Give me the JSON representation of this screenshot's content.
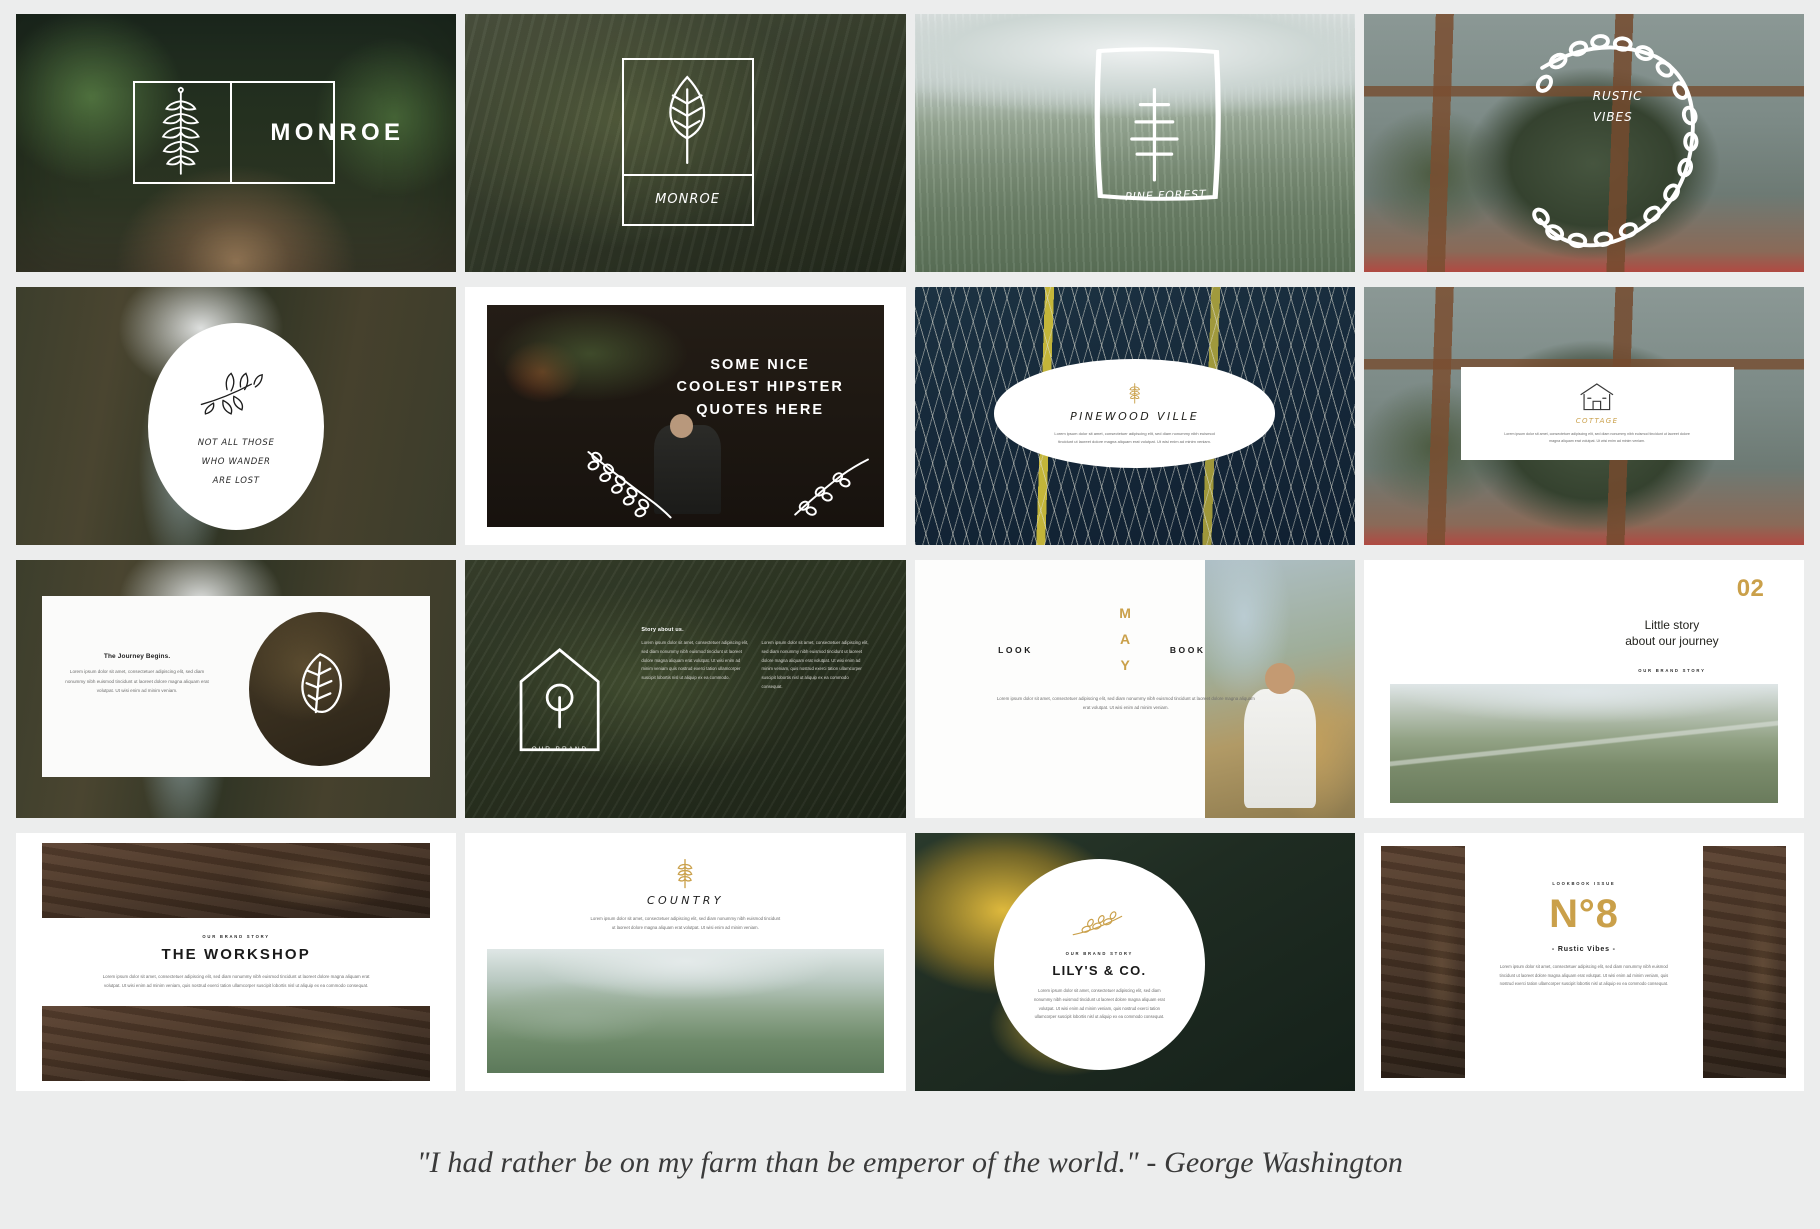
{
  "caption": "\"I had rather be on my farm than be emperor of the world.\" - George Washington",
  "palette": {
    "page_background": "#eceded",
    "slide_background": "#ffffff",
    "gold_accent": "#caa04a",
    "ink": "#1a1a1a",
    "muted_text": "#6d6d6d"
  },
  "lorem": {
    "short": "Lorem ipsum dolor sit amet, consectetuer adipiscing elit, sed diam nonummy nibh euismod tincidunt ut laoreet dolore magna aliquam erat volutpat. Ut wisi enim ad minim veniam.",
    "medium": "Lorem ipsum dolor sit amet, consectetuer adipiscing elit, sed diam nonummy nibh euismod tincidunt ut laoreet dolore magna aliquam erat volutpat. Ut wisi enim ad minim veniam, quis nostrud exerci tation ullamcorper suscipit lobortis nisl ut aliquip ex ea commodo consequat.",
    "column": "Lorem ipsum dolor sit amet, consectetuer adipiscing elit, sed diam nonummy nibh euismod tincidunt ut laoreet dolore magna aliquam erat volutpat. Ut wisi enim ad minim veniam quis nostrud exerci tation ullamcorper suscipit lobortis nisl ut aliquip ex ea commodo."
  },
  "slides": [
    {
      "id": "monroe-cover",
      "title": "MONROE",
      "icon": "fern-leaf-icon",
      "photo": "forest-bridge-photo",
      "layout": "framed-logo-lockup"
    },
    {
      "id": "monroe-leaf-badge",
      "title": "MONROE",
      "icon": "leaf-outline-icon",
      "photo": "tall-grass-photo",
      "layout": "vertical-frame-badge"
    },
    {
      "id": "pine-forest",
      "title": "PINE FOREST",
      "icon": "pine-tree-icon",
      "photo": "pine-forest-overlook-photo",
      "layout": "sketch-frame-title"
    },
    {
      "id": "rustic-vibes",
      "title_line1": "RUSTIC",
      "title_line2": "VIBES",
      "icon": "laurel-wreath-icon",
      "photo": "greenhouse-agave-photo",
      "layout": "wreath-title"
    },
    {
      "id": "wander-quote",
      "quote_line1": "NOT ALL THOSE",
      "quote_line2": "WHO WANDER",
      "quote_line3": "ARE LOST",
      "icon": "olive-branch-icon",
      "photo": "canyon-river-photo",
      "layout": "circle-quote"
    },
    {
      "id": "hipster-quotes",
      "quote_line1": "SOME NICE",
      "quote_line2": "COOLEST HIPSTER",
      "quote_line3": "QUOTES HERE",
      "icon": "vine-garland-icon",
      "photo": "hipster-portrait-photo",
      "layout": "full-bleed-quote"
    },
    {
      "id": "pinewood-ville",
      "title": "PINEWOOD VILLE",
      "icon": "wheat-sprig-icon",
      "photo": "palm-frond-photo",
      "layout": "oval-card"
    },
    {
      "id": "cottage",
      "title": "COTTAGE",
      "icon": "cottage-house-icon",
      "photo": "greenhouse-agave-photo",
      "layout": "paper-card"
    },
    {
      "id": "journey-begins",
      "title": "The Journey Begins.",
      "icon": "oak-leaf-icon",
      "photo": "canyon-river-photo",
      "layout": "panel-with-circle-photo"
    },
    {
      "id": "our-brand",
      "title": "OUR BRAND",
      "section_label": "Story about us.",
      "icon": "home-outline-icon",
      "photo": "hedge-leaves-photo",
      "layout": "badge-plus-two-columns"
    },
    {
      "id": "may-look-book",
      "month": "MAY",
      "left_label": "LOOK",
      "right_label": "BOOK",
      "photo": "cliffside-portrait-photo",
      "layout": "split-type-photo"
    },
    {
      "id": "little-story",
      "number": "02",
      "title_line1": "Little story",
      "title_line2": "about our journey",
      "kicker": "OUR BRAND STORY",
      "photo": "mountain-road-photo",
      "layout": "number-headline-photo"
    },
    {
      "id": "the-workshop",
      "kicker": "OUR BRAND STORY",
      "title": "THE WORKSHOP",
      "photo": "vintage-tools-photo",
      "layout": "banded-photo-title"
    },
    {
      "id": "country",
      "title": "COUNTRY",
      "icon": "wheat-sprig-icon",
      "photo": "misty-valley-photo",
      "layout": "title-over-photo"
    },
    {
      "id": "lilys-and-co",
      "kicker": "OUR BRAND STORY",
      "title": "LILY'S & CO.",
      "icon": "olive-sprig-gold-icon",
      "photo": "yellow-tulips-photo",
      "layout": "circle-card-brand"
    },
    {
      "id": "number-eight",
      "kicker": "LOOKBOOK ISSUE",
      "number": "N°8",
      "subtitle": "- Rustic Vibes -",
      "photo": "vintage-tools-photo",
      "layout": "triptych-number"
    }
  ]
}
